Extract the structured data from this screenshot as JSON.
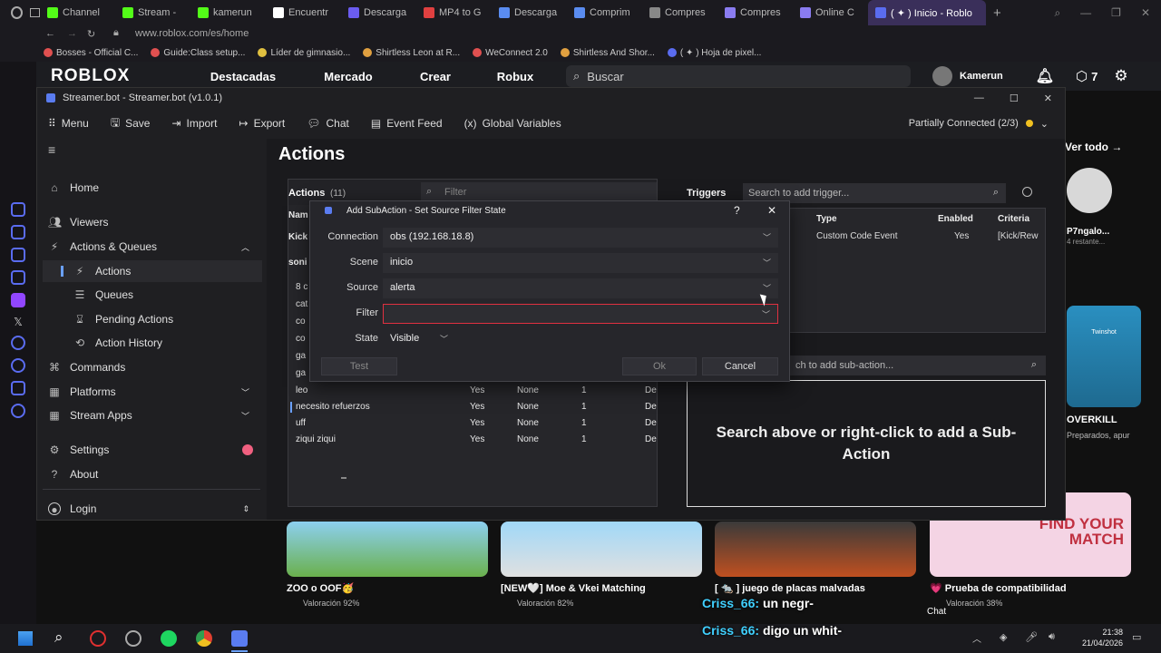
{
  "browser": {
    "tabs": [
      {
        "label": "Channel",
        "color": "#53fc18"
      },
      {
        "label": "Stream -",
        "color": "#53fc18"
      },
      {
        "label": "kamerun",
        "color": "#53fc18"
      },
      {
        "label": "Encuentr",
        "color": "#ffffff"
      },
      {
        "label": "Descarga",
        "color": "#6b5cf0"
      },
      {
        "label": "MP4 to G",
        "color": "#e04040"
      },
      {
        "label": "Descarga",
        "color": "#5a8cf0"
      },
      {
        "label": "Comprim",
        "color": "#5a8cf0"
      },
      {
        "label": "Compres",
        "color": "#888888"
      },
      {
        "label": "Compres",
        "color": "#8a7cf0"
      },
      {
        "label": "Online C",
        "color": "#8a7cf0"
      }
    ],
    "active_tab": "( ✦ ) Inicio - Roblo",
    "url": "www.roblox.com/es/home",
    "bookmarks": [
      {
        "label": "Bosses - Official C...",
        "color": "#e05050"
      },
      {
        "label": "Guide:Class setup...",
        "color": "#e05050"
      },
      {
        "label": "Líder de gimnasio...",
        "color": "#e0c040"
      },
      {
        "label": "Shirtless Leon at R...",
        "color": "#e0a040"
      },
      {
        "label": "WeConnect 2.0",
        "color": "#e05050"
      },
      {
        "label": "Shirtless And Shor...",
        "color": "#e0a040"
      },
      {
        "label": "( ✦ ) Hoja de pixel...",
        "color": "#5a6cf0"
      }
    ]
  },
  "roblox": {
    "logo": "ROBLOX",
    "nav": [
      "Destacadas",
      "Mercado",
      "Crear",
      "Robux"
    ],
    "search_placeholder": "Buscar",
    "username": "Kamerun",
    "robux_count": "7",
    "see_all": "Ver todo →",
    "friend_name": "P7ngalo...",
    "friend_sub": "4 restante...",
    "side_game_title": "OVERKILL",
    "side_game_sub": "Preparados, apur",
    "side_game_thumb_label": "Twinshot",
    "games": [
      {
        "title": "ZOO o OOF🥳",
        "rating": "Valoración 92%"
      },
      {
        "title": "[NEW🤍] Moe & Vkei Matching",
        "rating": "Valoración 82%"
      },
      {
        "title": "[ 🐀 ] juego de placas malvadas",
        "rating": ""
      },
      {
        "title": "💗 Prueba de compatibilidad",
        "rating": "Valoración 38%"
      }
    ],
    "find_match_thumb": "FIND YOUR MATCH",
    "chat_label": "Chat"
  },
  "overlay_chat": [
    {
      "user": "Criss_66:",
      "text": "un negr-"
    },
    {
      "user": "Criss_66:",
      "text": "digo un whit-"
    }
  ],
  "streamerbot": {
    "window_title": "Streamer.bot - Streamer.bot (v1.0.1)",
    "toolbar": [
      "Menu",
      "Save",
      "Import",
      "Export",
      "Chat",
      "Event Feed",
      "Global Variables"
    ],
    "connection_status": "Partially Connected (2/3)",
    "status_color": "#f0c020",
    "sidebar": {
      "items": [
        {
          "label": "Home",
          "icon": "home-icon"
        },
        {
          "label": "Viewers",
          "icon": "viewers-icon"
        },
        {
          "label": "Actions & Queues",
          "icon": "actions-icon"
        },
        {
          "label": "Actions",
          "icon": "bolt-icon"
        },
        {
          "label": "Queues",
          "icon": "queues-icon"
        },
        {
          "label": "Pending Actions",
          "icon": "pending-icon"
        },
        {
          "label": "Action History",
          "icon": "history-icon"
        },
        {
          "label": "Commands",
          "icon": "commands-icon"
        },
        {
          "label": "Platforms",
          "icon": "platforms-icon"
        },
        {
          "label": "Stream Apps",
          "icon": "apps-icon"
        },
        {
          "label": "Settings",
          "icon": "gear-icon"
        },
        {
          "label": "About",
          "icon": "help-icon"
        },
        {
          "label": "Login",
          "icon": "user-icon"
        }
      ]
    },
    "page_title": "Actions",
    "actions_panel": {
      "title": "Actions",
      "count": "(11)",
      "filter_placeholder": "Filter",
      "col_name_partial": "Nam",
      "partial_names": [
        "Kick",
        "soni"
      ],
      "rows": [
        {
          "name": "8 c",
          "enabled": "",
          "queue": "",
          "num": "",
          "d": ""
        },
        {
          "name": "cat",
          "enabled": "",
          "queue": "",
          "num": "",
          "d": ""
        },
        {
          "name": "co",
          "enabled": "",
          "queue": "",
          "num": "",
          "d": ""
        },
        {
          "name": "co",
          "enabled": "",
          "queue": "",
          "num": "",
          "d": ""
        },
        {
          "name": "ga",
          "enabled": "",
          "queue": "",
          "num": "",
          "d": ""
        },
        {
          "name": "ga",
          "enabled": "",
          "queue": "",
          "num": "",
          "d": ""
        },
        {
          "name": "leo",
          "enabled": "Yes",
          "queue": "None",
          "num": "1",
          "d": "De"
        },
        {
          "name": "necesito refuerzos",
          "enabled": "Yes",
          "queue": "None",
          "num": "1",
          "d": "De"
        },
        {
          "name": "uff",
          "enabled": "Yes",
          "queue": "None",
          "num": "1",
          "d": "De"
        },
        {
          "name": "ziqui ziqui",
          "enabled": "Yes",
          "queue": "None",
          "num": "1",
          "d": "De"
        }
      ]
    },
    "triggers_panel": {
      "title": "Triggers",
      "search_placeholder": "Search to add trigger...",
      "columns": [
        "Type",
        "Enabled",
        "Criteria"
      ],
      "rows": [
        {
          "type": "Custom Code Event",
          "enabled": "Yes",
          "criteria": "[Kick/Rew"
        }
      ]
    },
    "subactions_panel": {
      "search_placeholder": "ch to add sub-action...",
      "empty_text": "Search above or right-click to add a Sub-Action"
    },
    "dialog": {
      "title": "Add SubAction - Set Source Filter State",
      "help": "?",
      "fields": [
        {
          "label": "Connection",
          "value": "obs (192.168.18.8)"
        },
        {
          "label": "Scene",
          "value": "inicio"
        },
        {
          "label": "Source",
          "value": "alerta"
        },
        {
          "label": "Filter",
          "value": ""
        },
        {
          "label": "State",
          "value": "Visible"
        }
      ],
      "test_label": "Test",
      "ok_label": "Ok",
      "cancel_label": "Cancel"
    }
  },
  "taskbar": {
    "time": "21:38",
    "date": "21/04/2026"
  }
}
